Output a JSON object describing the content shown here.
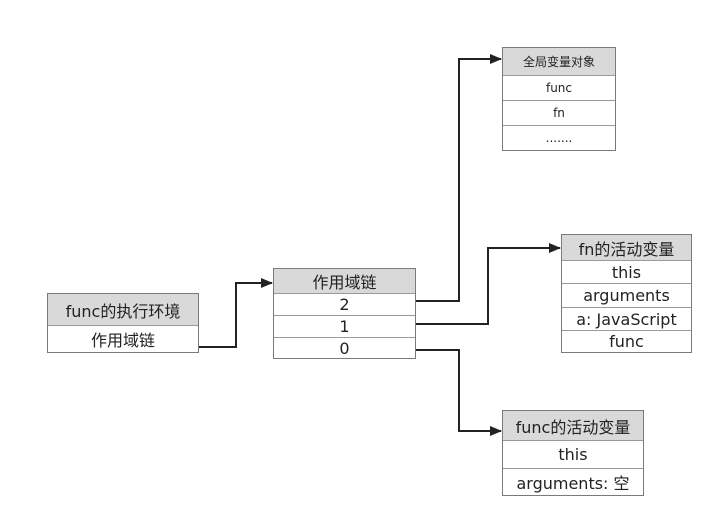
{
  "exec_context": {
    "title": "func的执行环境",
    "rows": [
      "作用域链"
    ]
  },
  "scope_chain": {
    "title": "作用域链",
    "rows": [
      "2",
      "1",
      "0"
    ]
  },
  "global_object": {
    "title": "全局变量对象",
    "rows": [
      "func",
      "fn",
      "......."
    ]
  },
  "fn_activation": {
    "title": "fn的活动变量",
    "rows": [
      "this",
      "arguments",
      "a: JavaScript",
      "func"
    ]
  },
  "func_activation": {
    "title": "func的活动变量",
    "rows": [
      "this",
      "arguments: 空"
    ]
  },
  "colors": {
    "header_bg": "#d9d9d9",
    "border": "#7a7a7a",
    "line": "#222222"
  }
}
